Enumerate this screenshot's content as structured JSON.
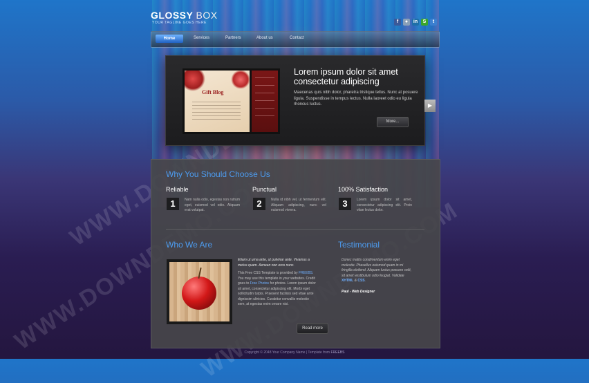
{
  "header": {
    "logo_bold": "GLOSSY",
    "logo_light": "BOX",
    "tagline": "YOUR TAGLINE GOES HERE",
    "social": [
      {
        "icon": "facebook-icon",
        "glyph": "f",
        "color": "#3b5998"
      },
      {
        "icon": "flickr-icon",
        "glyph": "●",
        "color": "#8aa0b8"
      },
      {
        "icon": "linkedin-icon",
        "glyph": "in",
        "color": "#1e6fa8"
      },
      {
        "icon": "skype-icon",
        "glyph": "S",
        "color": "#3aa62a"
      },
      {
        "icon": "twitter-icon",
        "glyph": "t",
        "color": "#3b7fd0"
      }
    ]
  },
  "nav": {
    "home": "Home",
    "services": "Services",
    "partners": "Partners",
    "about": "About us",
    "contact": "Contact"
  },
  "slider": {
    "image_title": "Gift Blog",
    "title": "Lorem ipsum dolor sit amet consectetur adipiscing",
    "text": "Maecenas quis nibh dolor, pharetra tristique tellus. Nunc at posuere ligula. Suspendisse in tempus lectus. Nulla laoreet odio eu ligula rhoncus luctus.",
    "more": "More...",
    "next_glyph": "▶"
  },
  "why": {
    "heading": "Why You Should Choose Us",
    "features": [
      {
        "num": "1",
        "title": "Reliable",
        "text": "Nam nulla odio, egestas non rutrum eget, euismod vel odio. Aliquam erat volutpat."
      },
      {
        "num": "2",
        "title": "Punctual",
        "text": "Nulla id nibh vel, ut fermentum elit. Aliquam adipiscing, nunc vel euismod viverra."
      },
      {
        "num": "3",
        "title": "100% Satisfaction",
        "text": "Lorem ipsum dolor sit amet, consectetur adipiscing elit. Proin vitae lectus dolor."
      }
    ]
  },
  "who": {
    "heading": "Who We Are",
    "lead": "Etiam ut urna ante, ut pulvinar ante. Vivamus a metus quam. Aenean non eros nunc.",
    "text1": "This Free CSS Template is provided by",
    "link1": "FREEBS",
    "text2": "You may use this template in your websites. Credit goes to",
    "link2": "Free Photos",
    "text3": "for photos. Lorem ipsum dolor sit amet, consectetur adipiscing elit. Morbi eget sollicitudin turpis. Praesent facilisis sed vitae ante dignissim ultricies. Curabitur convallis molestie sem, at egestas enim ornare nisi.",
    "read_more": "Read more"
  },
  "testimonial": {
    "heading": "Testimonial",
    "quote": "Donec mattis condimentum enim eget molestie. Phasellus euismod quam in mi fringilla eleifend. Aliquam luctus posuere velit, sit amet vestibulum odio feugiat. Validate",
    "link1": "XHTML",
    "and": "&",
    "link2": "CSS",
    "author": "Paul - Web Designer"
  },
  "footer": {
    "text": "Copyright © 2048 Your Company Name | Template from",
    "link": "FREEBS"
  },
  "watermark": "WWW.DOWNDEMO.COM"
}
